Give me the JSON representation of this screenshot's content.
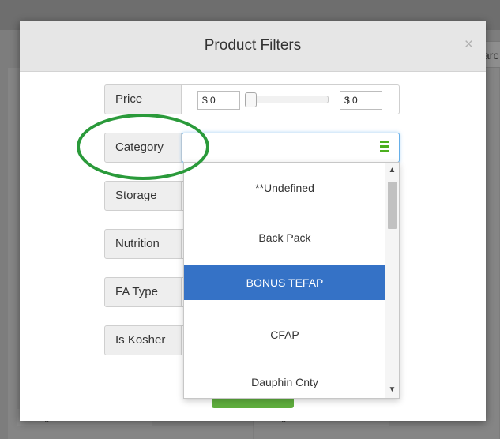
{
  "background": {
    "search_text": "arc",
    "select_left": "Storage",
    "select_right": "Storage"
  },
  "modal": {
    "title": "Product Filters",
    "close_glyph": "×"
  },
  "filters": {
    "price": {
      "label": "Price",
      "min": "$ 0",
      "max": "$ 0"
    },
    "category": {
      "label": "Category",
      "icon": "list-menu-icon"
    },
    "storage": {
      "label": "Storage"
    },
    "nutrition": {
      "label": "Nutrition"
    },
    "fa_type": {
      "label": "FA Type"
    },
    "is_kosher": {
      "label": "Is Kosher"
    }
  },
  "category_dropdown": {
    "options": [
      "**Undefined",
      "Back Pack",
      "BONUS TEFAP",
      "CFAP",
      "Dauphin Cnty"
    ],
    "selected": "BONUS TEFAP"
  },
  "colors": {
    "accent_green": "#4caf1f",
    "highlight_blue": "#3572c6",
    "annotation_circle": "#2a9a3a"
  }
}
